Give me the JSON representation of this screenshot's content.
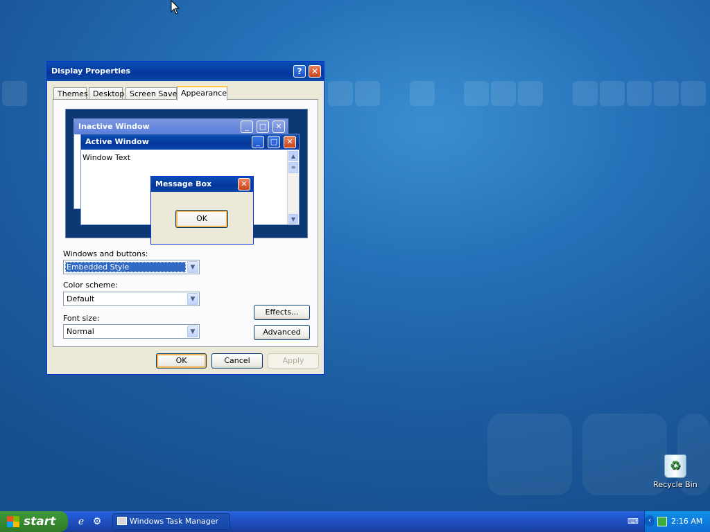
{
  "window": {
    "title": "Display Properties",
    "help_label": "?",
    "close_label": "✕",
    "tabs": [
      {
        "label": "Themes"
      },
      {
        "label": "Desktop"
      },
      {
        "label": "Screen Saver"
      },
      {
        "label": "Appearance"
      }
    ],
    "selected_tab": "Appearance"
  },
  "preview": {
    "inactive_title": "Inactive Window",
    "active_title": "Active Window",
    "window_text": "Window Text",
    "message_title": "Message Box",
    "ok_label": "OK"
  },
  "appearance": {
    "windows_buttons_label": "Windows and buttons:",
    "windows_buttons_value": "Embedded Style",
    "color_scheme_label": "Color scheme:",
    "color_scheme_value": "Default",
    "font_size_label": "Font size:",
    "font_size_value": "Normal",
    "effects_label": "Effects...",
    "advanced_label": "Advanced"
  },
  "dialog_buttons": {
    "ok": "OK",
    "cancel": "Cancel",
    "apply": "Apply"
  },
  "desktop": {
    "recycle_bin_label": "Recycle Bin"
  },
  "taskbar": {
    "start_label": "start",
    "task_label": "Windows Task Manager",
    "clock": "2:16 AM"
  },
  "colors": {
    "titlebar": "#0a4fb5",
    "dialog_bg": "#ece9d8",
    "selection": "#316ac5",
    "start_green": "#388a2f",
    "taskbar_blue": "#245edb"
  }
}
